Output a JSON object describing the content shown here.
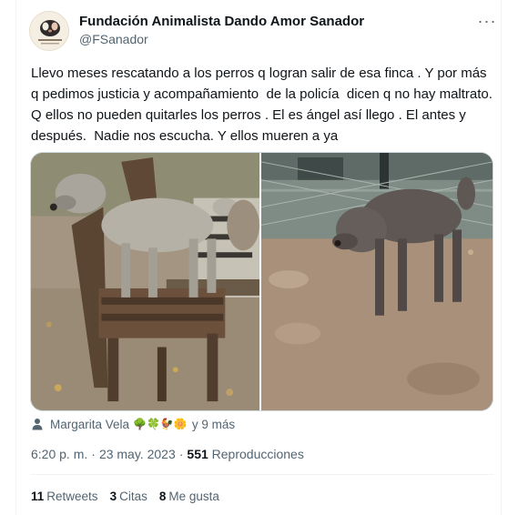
{
  "author": {
    "name": "Fundación Animalista Dando Amor Sanador",
    "handle": "@FSanador"
  },
  "tweet": {
    "text": "Llevo meses rescatando a los perros q logran salir de esa finca . Y por más q pedimos justicia y acompañamiento  de la policía  dicen q no hay maltrato.  Q ellos no pueden quitarles los perros . El es ángel así llego . El antes y después.  Nadie nos escucha. Y ellos mueren a ya"
  },
  "media": {
    "count": 2,
    "icons": [
      "dog-on-chair-photo",
      "dog-in-yard-photo"
    ]
  },
  "tagged": {
    "names": "Margarita Vela",
    "emojis": "🌳🍀🐓🌼",
    "more": "y 9 más",
    "icon": "person-icon"
  },
  "meta": {
    "time": "6:20 p. m.",
    "separator": "·",
    "date": "23 may. 2023",
    "views_count": "551",
    "views_label": "Reproducciones"
  },
  "stats": {
    "retweets_count": "11",
    "retweets_label": "Retweets",
    "quotes_count": "3",
    "quotes_label": "Citas",
    "likes_count": "8",
    "likes_label": "Me gusta"
  },
  "colors": {
    "primary_text": "#0f1419",
    "secondary_text": "#536471",
    "border": "#eff3f4"
  }
}
